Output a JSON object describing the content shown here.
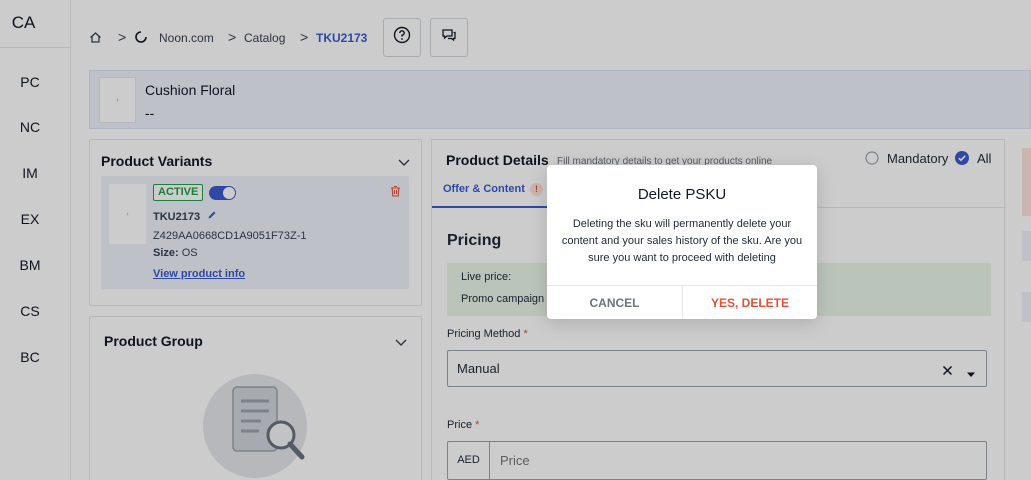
{
  "sidebar": {
    "logo": "CA",
    "items": [
      "PC",
      "NC",
      "IM",
      "EX",
      "BM",
      "CS",
      "BC"
    ]
  },
  "breadcrumb": {
    "store": "Noon.com",
    "catalog": "Catalog",
    "current": "TKU2173",
    "separator": ">"
  },
  "banner": {
    "title": "Cushion Floral",
    "subtitle": "--",
    "thumb_alt": "›"
  },
  "variants": {
    "title": "Product Variants",
    "status": "ACTIVE",
    "sku": "TKU2173",
    "id": "Z429AA0668CD1A9051F73Z-1",
    "size_label": "Size:",
    "size_value": "OS",
    "link": "View product info",
    "thumb_alt": "›"
  },
  "product_group": {
    "title": "Product Group"
  },
  "details": {
    "title": "Product Details",
    "hint": "Fill mandatory details to get your products online",
    "filter_mandatory": "Mandatory",
    "filter_all": "All",
    "tab": "Offer & Content",
    "tab_alert": "!",
    "pricing_title": "Pricing",
    "live_price": "Live price:",
    "promo": "Promo campaign",
    "pricing_method_label": "Pricing Method",
    "required_mark": "*",
    "pricing_method_value": "Manual",
    "price_label": "Price",
    "currency": "AED",
    "price_placeholder": "Price"
  },
  "modal": {
    "title": "Delete PSKU",
    "body": "Deleting the sku will permanently delete your content and your sales history of the sku. Are you sure you want to proceed with deleting",
    "cancel": "CANCEL",
    "confirm": "YES, DELETE"
  },
  "colors": {
    "accent": "#3b5bcc",
    "active": "#22a04b",
    "danger": "#e0533a"
  }
}
